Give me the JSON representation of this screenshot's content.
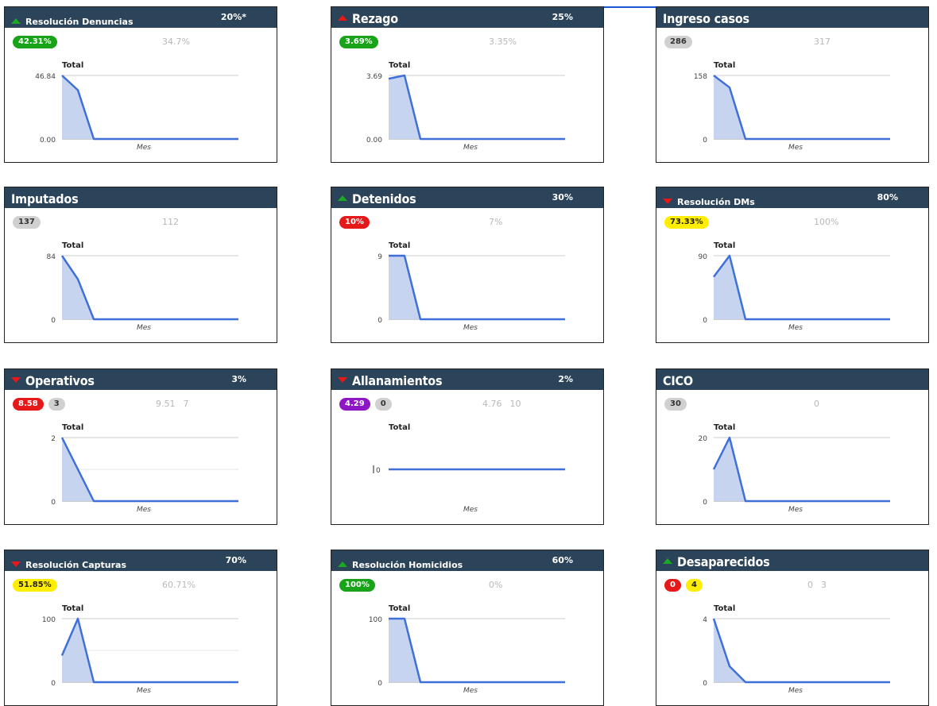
{
  "cards": [
    {
      "title": "Resolución Denuncias",
      "size": "small",
      "arrow": "up",
      "goal": "20%*",
      "badges": [
        {
          "text": "42.31%",
          "color": "green"
        }
      ],
      "prev": [
        "34.7%"
      ],
      "chart_data": {
        "type": "area",
        "title": "Total",
        "xlabel": "Mes",
        "ytick_top": "46.84",
        "ytick_bottom": "0.00",
        "ymax": 46.84,
        "values": [
          46.84,
          36,
          0,
          0,
          0,
          0,
          0,
          0,
          0,
          0,
          0,
          0
        ]
      }
    },
    {
      "title": "Rezago",
      "size": "big",
      "arrow": "up-red",
      "goal": "25%",
      "badges": [
        {
          "text": "3.69%",
          "color": "green"
        }
      ],
      "prev": [
        "3.35%"
      ],
      "chart_data": {
        "type": "area",
        "title": "Total",
        "xlabel": "Mes",
        "ytick_top": "3.69",
        "ytick_bottom": "0.00",
        "ymax": 3.69,
        "values": [
          3.5,
          3.69,
          0,
          0,
          0,
          0,
          0,
          0,
          0,
          0,
          0,
          0
        ]
      }
    },
    {
      "title": "Ingreso casos",
      "size": "big",
      "arrow": "none",
      "goal": "",
      "badges": [
        {
          "text": "286",
          "color": "grey"
        }
      ],
      "prev": [
        "317"
      ],
      "chart_data": {
        "type": "area",
        "title": "Total",
        "xlabel": "Mes",
        "ytick_top": "158",
        "ytick_bottom": "0",
        "ymax": 158,
        "values": [
          158,
          128,
          0,
          0,
          0,
          0,
          0,
          0,
          0,
          0,
          0,
          0
        ]
      }
    },
    {
      "title": "Imputados",
      "size": "big",
      "arrow": "none",
      "goal": "",
      "badges": [
        {
          "text": "137",
          "color": "grey"
        }
      ],
      "prev": [
        "112"
      ],
      "chart_data": {
        "type": "area",
        "title": "Total",
        "xlabel": "Mes",
        "ytick_top": "84",
        "ytick_bottom": "0",
        "ymax": 84,
        "values": [
          84,
          53,
          0,
          0,
          0,
          0,
          0,
          0,
          0,
          0,
          0,
          0
        ]
      }
    },
    {
      "title": "Detenidos",
      "size": "big",
      "arrow": "up",
      "goal": "30%",
      "badges": [
        {
          "text": "10%",
          "color": "red"
        }
      ],
      "prev": [
        "7%"
      ],
      "chart_data": {
        "type": "area",
        "title": "Total",
        "xlabel": "Mes",
        "ytick_top": "9",
        "ytick_bottom": "0",
        "ymax": 9,
        "values": [
          9,
          9,
          0,
          0,
          0,
          0,
          0,
          0,
          0,
          0,
          0,
          0
        ]
      }
    },
    {
      "title": "Resolución DMs",
      "size": "small",
      "arrow": "down",
      "goal": "80%",
      "badges": [
        {
          "text": "73.33%",
          "color": "yellow"
        }
      ],
      "prev": [
        "100%"
      ],
      "chart_data": {
        "type": "area",
        "title": "Total",
        "xlabel": "Mes",
        "ytick_top": "90",
        "ytick_bottom": "0",
        "ymax": 90,
        "values": [
          60,
          90,
          0,
          0,
          0,
          0,
          0,
          0,
          0,
          0,
          0,
          0
        ]
      }
    },
    {
      "title": "Operativos",
      "size": "big",
      "arrow": "down",
      "goal": "3%",
      "badges": [
        {
          "text": "8.58",
          "color": "red"
        },
        {
          "text": "3",
          "color": "grey"
        }
      ],
      "prev": [
        "9.51",
        "7"
      ],
      "chart_data": {
        "type": "area",
        "title": "Total",
        "xlabel": "Mes",
        "ytick_top": "2",
        "ytick_bottom": "0",
        "ymax": 2,
        "values": [
          2,
          1,
          0,
          0,
          0,
          0,
          0,
          0,
          0,
          0,
          0,
          0
        ]
      }
    },
    {
      "title": "Allanamientos",
      "size": "big",
      "arrow": "down",
      "goal": "2%",
      "badges": [
        {
          "text": "4.29",
          "color": "purple"
        },
        {
          "text": "0",
          "color": "grey"
        }
      ],
      "prev": [
        "4.76",
        "10"
      ],
      "chart_data": {
        "type": "flat",
        "title": "Total",
        "xlabel": "Mes",
        "ytick_top": "",
        "ytick_bottom": "0",
        "ymax": 0,
        "values": [
          0,
          0,
          0,
          0,
          0,
          0,
          0,
          0,
          0,
          0,
          0,
          0
        ]
      }
    },
    {
      "title": "CICO",
      "size": "big",
      "arrow": "none",
      "goal": "",
      "badges": [
        {
          "text": "30",
          "color": "grey"
        }
      ],
      "prev": [
        "0"
      ],
      "chart_data": {
        "type": "area",
        "title": "Total",
        "xlabel": "Mes",
        "ytick_top": "20",
        "ytick_bottom": "0",
        "ymax": 20,
        "values": [
          10,
          20,
          0,
          0,
          0,
          0,
          0,
          0,
          0,
          0,
          0,
          0
        ]
      }
    },
    {
      "title": "Resolución Capturas",
      "size": "small",
      "arrow": "down",
      "goal": "70%",
      "badges": [
        {
          "text": "51.85%",
          "color": "yellow"
        }
      ],
      "prev": [
        "60.71%"
      ],
      "chart_data": {
        "type": "area",
        "title": "Total",
        "xlabel": "Mes",
        "ytick_top": "100",
        "ytick_bottom": "0",
        "ymax": 100,
        "values": [
          42,
          100,
          0,
          0,
          0,
          0,
          0,
          0,
          0,
          0,
          0,
          0
        ]
      }
    },
    {
      "title": "Resolución Homicidios",
      "size": "small",
      "arrow": "up",
      "goal": "60%",
      "badges": [
        {
          "text": "100%",
          "color": "green"
        }
      ],
      "prev": [
        "0%"
      ],
      "chart_data": {
        "type": "area",
        "title": "Total",
        "xlabel": "Mes",
        "ytick_top": "100",
        "ytick_bottom": "0",
        "ymax": 100,
        "values": [
          100,
          100,
          0,
          0,
          0,
          0,
          0,
          0,
          0,
          0,
          0,
          0
        ]
      }
    },
    {
      "title": "Desaparecidos",
      "size": "big",
      "arrow": "up",
      "goal": "",
      "badges": [
        {
          "text": "0",
          "color": "red"
        },
        {
          "text": "4",
          "color": "yellow"
        }
      ],
      "prev": [
        "0",
        "3"
      ],
      "chart_data": {
        "type": "area",
        "title": "Total",
        "xlabel": "Mes",
        "ytick_top": "4",
        "ytick_bottom": "0",
        "ymax": 4,
        "values": [
          4,
          1,
          0,
          0,
          0,
          0,
          0,
          0,
          0,
          0,
          0,
          0
        ]
      }
    }
  ],
  "colors": {
    "header": "#2c4459",
    "line": "#3f6fd8",
    "fill": "#c6d4f0",
    "grid": "#cccccc"
  }
}
